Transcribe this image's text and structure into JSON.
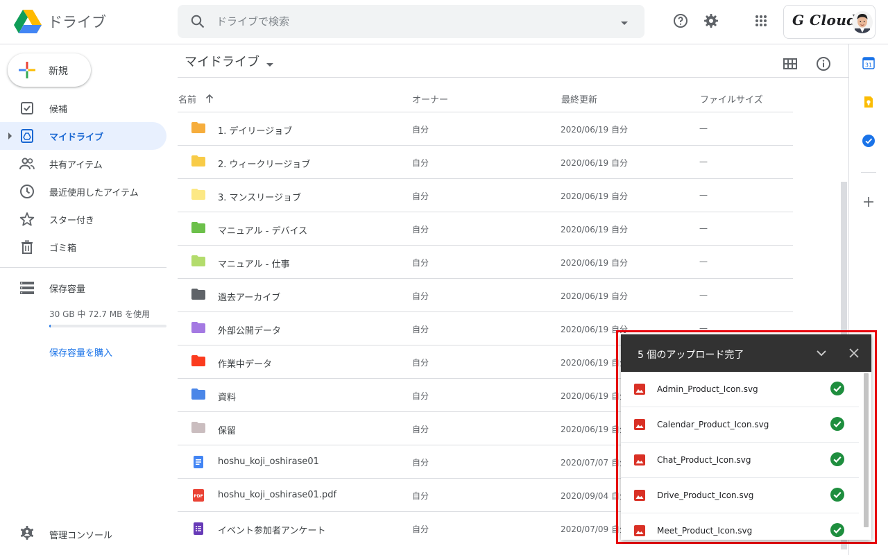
{
  "header": {
    "app_name": "ドライブ",
    "search_placeholder": "ドライブで検索",
    "brand": "G Cloud"
  },
  "sidebar": {
    "new_label": "新規",
    "items": [
      {
        "label": "候補",
        "icon": "checkbox-icon"
      },
      {
        "label": "マイドライブ",
        "icon": "my-drive-icon",
        "active": true
      },
      {
        "label": "共有アイテム",
        "icon": "people-icon"
      },
      {
        "label": "最近使用したアイテム",
        "icon": "clock-icon"
      },
      {
        "label": "スター付き",
        "icon": "star-icon"
      },
      {
        "label": "ゴミ箱",
        "icon": "trash-icon"
      }
    ],
    "storage_title": "保存容量",
    "storage_text": "30 GB 中 72.7 MB を使用",
    "storage_used_fraction": 0.0024,
    "buy_storage": "保存容量を購入",
    "admin_console": "管理コンソール"
  },
  "main": {
    "breadcrumb": "マイドライブ",
    "columns": {
      "name": "名前",
      "owner": "オーナー",
      "modified": "最終更新",
      "size": "ファイルサイズ"
    },
    "files": [
      {
        "name": "1. デイリージョブ",
        "owner": "自分",
        "modified": "2020/06/19 自分",
        "size": "—",
        "type": "folder",
        "color": "#f6ad3c"
      },
      {
        "name": "2. ウィークリージョブ",
        "owner": "自分",
        "modified": "2020/06/19 自分",
        "size": "—",
        "type": "folder",
        "color": "#f8cb47"
      },
      {
        "name": "3. マンスリージョブ",
        "owner": "自分",
        "modified": "2020/06/19 自分",
        "size": "—",
        "type": "folder",
        "color": "#fce884"
      },
      {
        "name": "マニュアル - デバイス",
        "owner": "自分",
        "modified": "2020/06/19 自分",
        "size": "—",
        "type": "folder",
        "color": "#6cc04a"
      },
      {
        "name": "マニュアル - 仕事",
        "owner": "自分",
        "modified": "2020/06/19 自分",
        "size": "—",
        "type": "folder",
        "color": "#b3dc6c"
      },
      {
        "name": "過去アーカイブ",
        "owner": "自分",
        "modified": "2020/06/19 自分",
        "size": "—",
        "type": "folder",
        "color": "#5f6368"
      },
      {
        "name": "外部公開データ",
        "owner": "自分",
        "modified": "2020/06/19 自分",
        "size": "—",
        "type": "folder",
        "color": "#a479e2"
      },
      {
        "name": "作業中データ",
        "owner": "自分",
        "modified": "2020/06/19 自分",
        "size": "—",
        "type": "folder",
        "color": "#fb3b1e"
      },
      {
        "name": "資料",
        "owner": "自分",
        "modified": "2020/06/19 自分",
        "size": "—",
        "type": "folder",
        "color": "#4a86e8"
      },
      {
        "name": "保留",
        "owner": "自分",
        "modified": "2020/06/19 自分",
        "size": "—",
        "type": "folder",
        "color": "#cabdbf"
      },
      {
        "name": "hoshu_koji_oshirase01",
        "owner": "自分",
        "modified": "2020/07/07 自分",
        "size": "—",
        "type": "doc",
        "color": "#4285f4"
      },
      {
        "name": "hoshu_koji_oshirase01.pdf",
        "owner": "自分",
        "modified": "2020/09/04 自分",
        "size": "—",
        "type": "pdf",
        "color": "#ea4335"
      },
      {
        "name": "イベント参加者アンケート",
        "owner": "自分",
        "modified": "2020/07/09 自分",
        "size": "—",
        "type": "form",
        "color": "#673ab7"
      }
    ]
  },
  "upload": {
    "title": "5 個のアップロード完了",
    "items": [
      {
        "name": "Admin_Product_Icon.svg"
      },
      {
        "name": "Calendar_Product_Icon.svg"
      },
      {
        "name": "Chat_Product_Icon.svg"
      },
      {
        "name": "Drive_Product_Icon.svg"
      },
      {
        "name": "Meet_Product_Icon.svg"
      }
    ]
  },
  "colors": {
    "accent": "#1a73e8",
    "highlight": "#e8000d",
    "success": "#1e8e3e"
  }
}
